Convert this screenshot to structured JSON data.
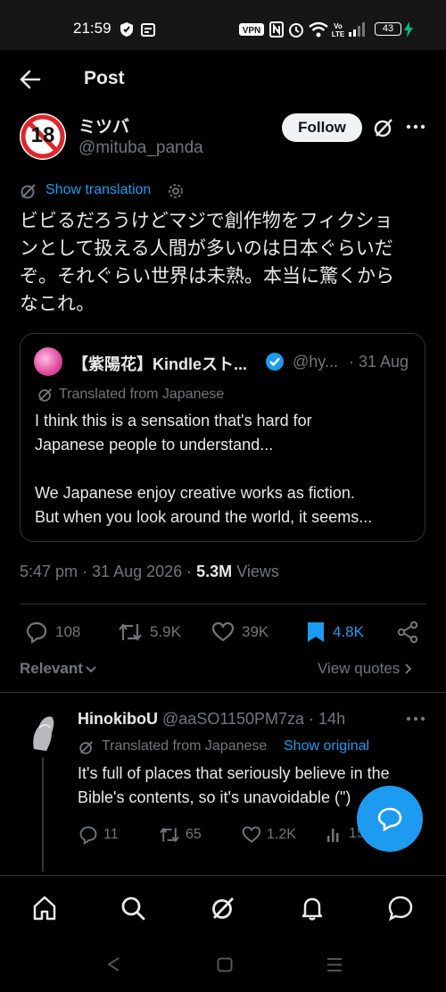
{
  "status_bar": {
    "time": "21:59",
    "battery": "43"
  },
  "header": {
    "title": "Post"
  },
  "author": {
    "name": "ミツバ",
    "handle": "@mituba_panda",
    "avatar_text": "18"
  },
  "follow_label": "Follow",
  "show_translation": "Show translation",
  "post_text_lines": [
    "ビビるだろうけどマジで創作物をフィクショ",
    "ンとして扱える人間が多いのは日本ぐらいだ",
    "ぞ。それぐらい世界は未熟。本当に驚くから",
    "なこれ。"
  ],
  "quote": {
    "name": "【紫陽花】Kindleスト...",
    "handle": "@hy...",
    "date": "· 31 Aug",
    "translated_label": "Translated from Japanese",
    "lines": [
      "I think this is a sensation that's hard for",
      "Japanese people to understand...",
      "",
      "We Japanese enjoy creative works as fiction.",
      "But when you look around the world, it seems..."
    ]
  },
  "meta": {
    "time_date": "5:47 pm · 31 Aug 2026 ·",
    "views_count": "5.3M",
    "views_label": "Views"
  },
  "actions": {
    "replies": "108",
    "reposts": "5.9K",
    "likes": "39K",
    "bookmarks": "4.8K"
  },
  "sort": {
    "relevant": "Relevant",
    "view_quotes": "View quotes"
  },
  "reply": {
    "name": "HinokiboU",
    "handle": "@aaSO1150PM7za · 14h",
    "translated_label": "Translated from Japanese",
    "show_original": "Show original",
    "lines": [
      "It's full of places that seriously believe in the",
      "Bible's contents, so it's unavoidable (\")"
    ],
    "replies": "11",
    "reposts": "65",
    "likes": "1.2K",
    "views": "15"
  },
  "colors": {
    "accent": "#1d9bf0",
    "background": "#000000",
    "text": "#e7e9ea",
    "muted": "#71767b"
  }
}
